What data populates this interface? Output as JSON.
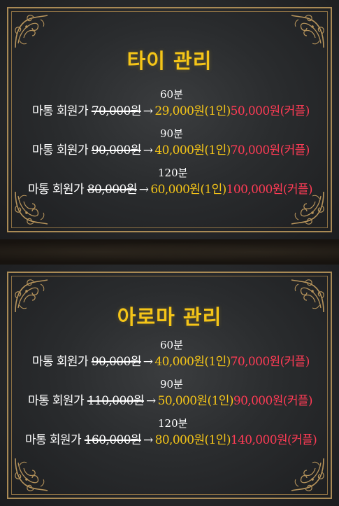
{
  "colors": {
    "title": "#f5c518",
    "single_price": "#f5c518",
    "couple_price": "#ff3b55",
    "text": "#ffffff",
    "frame_gold": "#a98a55",
    "panel_bg": "#2e3032"
  },
  "arrow": "→",
  "panels": [
    {
      "title": "타이 관리",
      "rows": [
        {
          "duration": "60분",
          "label": "마통 회원가",
          "old_price": "70,000원",
          "single": "29,000원(1인)",
          "couple": "50,000원(커플)"
        },
        {
          "duration": "90분",
          "label": "마통 회원가",
          "old_price": "90,000원",
          "single": "40,000원(1인)",
          "couple": "70,000원(커플)"
        },
        {
          "duration": "120분",
          "label": "마통 회원가",
          "old_price": "80,000원",
          "single": "60,000원(1인)",
          "couple": "100,000원(커플)"
        }
      ]
    },
    {
      "title": "아로마 관리",
      "rows": [
        {
          "duration": "60분",
          "label": "마통 회원가",
          "old_price": "90,000원",
          "single": "40,000원(1인)",
          "couple": "70,000원(커플)"
        },
        {
          "duration": "90분",
          "label": "마통 회원가",
          "old_price": "110,000원",
          "single": "50,000원(1인)",
          "couple": "90,000원(커플)"
        },
        {
          "duration": "120분",
          "label": "마통 회원가",
          "old_price": "160,000원",
          "single": "80,000원(1인)",
          "couple": "140,000원(커플)"
        }
      ]
    }
  ]
}
